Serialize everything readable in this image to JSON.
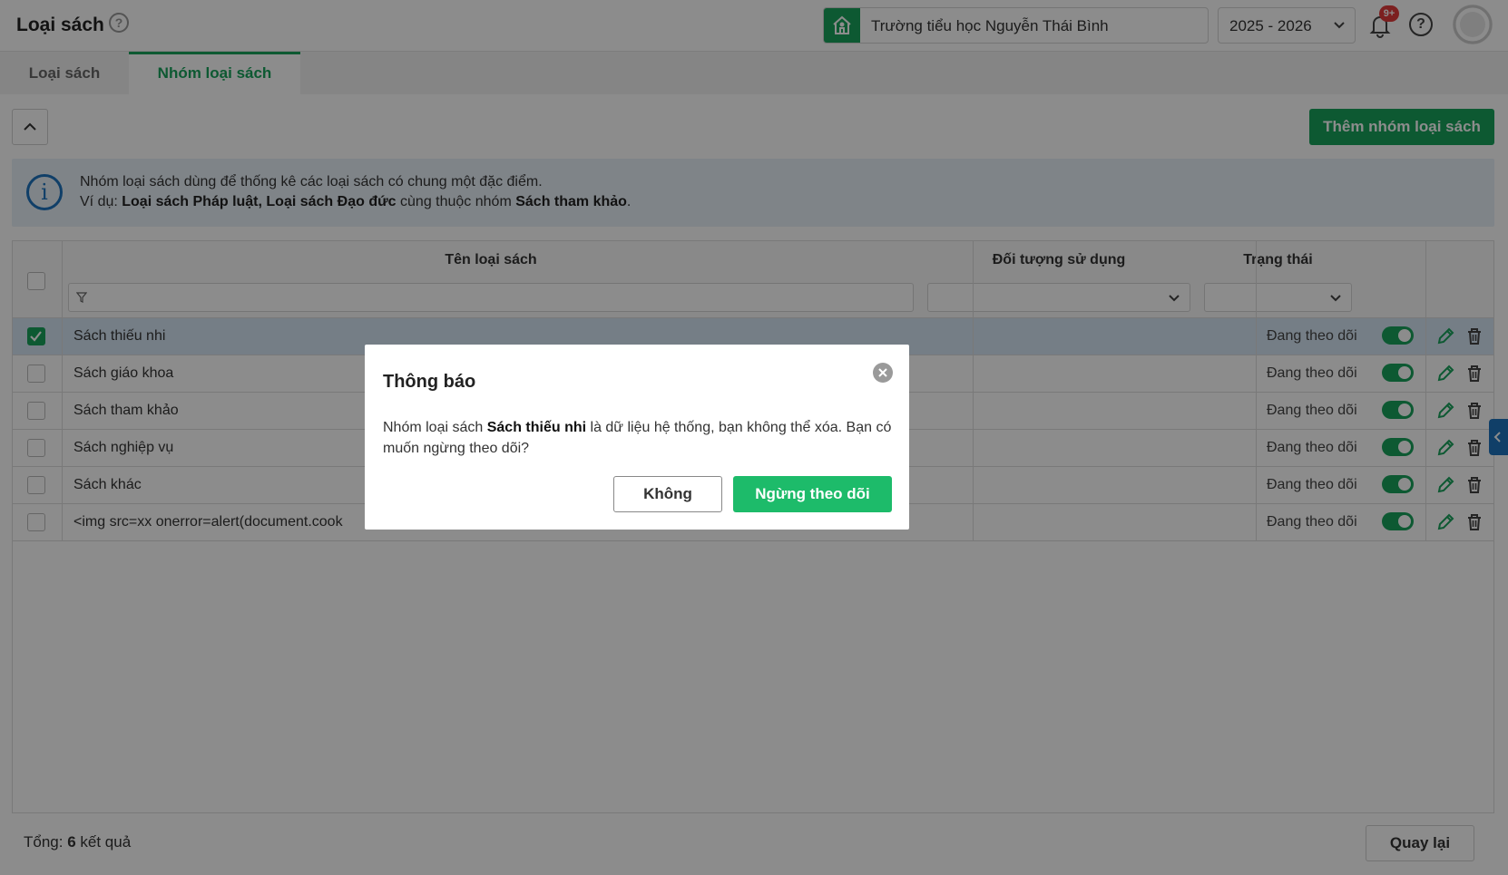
{
  "header": {
    "title": "Loại sách",
    "school": "Trường tiểu học Nguyễn Thái Bình",
    "year": "2025 - 2026",
    "notification_badge": "9+"
  },
  "tabs": [
    {
      "label": "Loại sách",
      "active": false
    },
    {
      "label": "Nhóm loại sách",
      "active": true
    }
  ],
  "toolbar": {
    "add_label": "Thêm nhóm loại sách"
  },
  "info": {
    "line1": "Nhóm loại sách dùng để thống kê các loại sách có chung một đặc điểm.",
    "line2_prefix": "Ví dụ: ",
    "line2_bold1": "Loại sách Pháp luật, Loại sách Đạo đức",
    "line2_mid": " cùng thuộc nhóm ",
    "line2_bold2": "Sách tham khảo",
    "line2_suffix": "."
  },
  "table": {
    "columns": [
      "Tên loại sách",
      "Đối tượng sử dụng",
      "Trạng thái"
    ],
    "rows": [
      {
        "name": "Sách thiếu nhi",
        "target": "",
        "status": "Đang theo dõi",
        "checked": true
      },
      {
        "name": "Sách giáo khoa",
        "target": "",
        "status": "Đang theo dõi",
        "checked": false
      },
      {
        "name": "Sách tham khảo",
        "target": "",
        "status": "Đang theo dõi",
        "checked": false
      },
      {
        "name": "Sách nghiệp vụ",
        "target": "",
        "status": "Đang theo dõi",
        "checked": false
      },
      {
        "name": "Sách khác",
        "target": "",
        "status": "Đang theo dõi",
        "checked": false
      },
      {
        "name": "<img src=xx onerror=alert(document.cook",
        "target": "",
        "status": "Đang theo dõi",
        "checked": false
      }
    ]
  },
  "footer": {
    "total_label": "Tổng: ",
    "total_count": "6",
    "total_suffix": " kết quả",
    "back_label": "Quay lại"
  },
  "modal": {
    "title": "Thông báo",
    "body_prefix": "Nhóm loại sách ",
    "body_bold": "Sách thiếu nhi",
    "body_suffix": " là dữ liệu hệ thống, bạn không thể xóa. Bạn có muốn ngừng theo dõi?",
    "cancel_label": "Không",
    "confirm_label": "Ngừng theo dõi"
  },
  "colors": {
    "accent": "#19a35c",
    "confirm": "#1dbb6a",
    "info_bg": "#e8f0f8",
    "selected_row": "#d6e6f5"
  }
}
